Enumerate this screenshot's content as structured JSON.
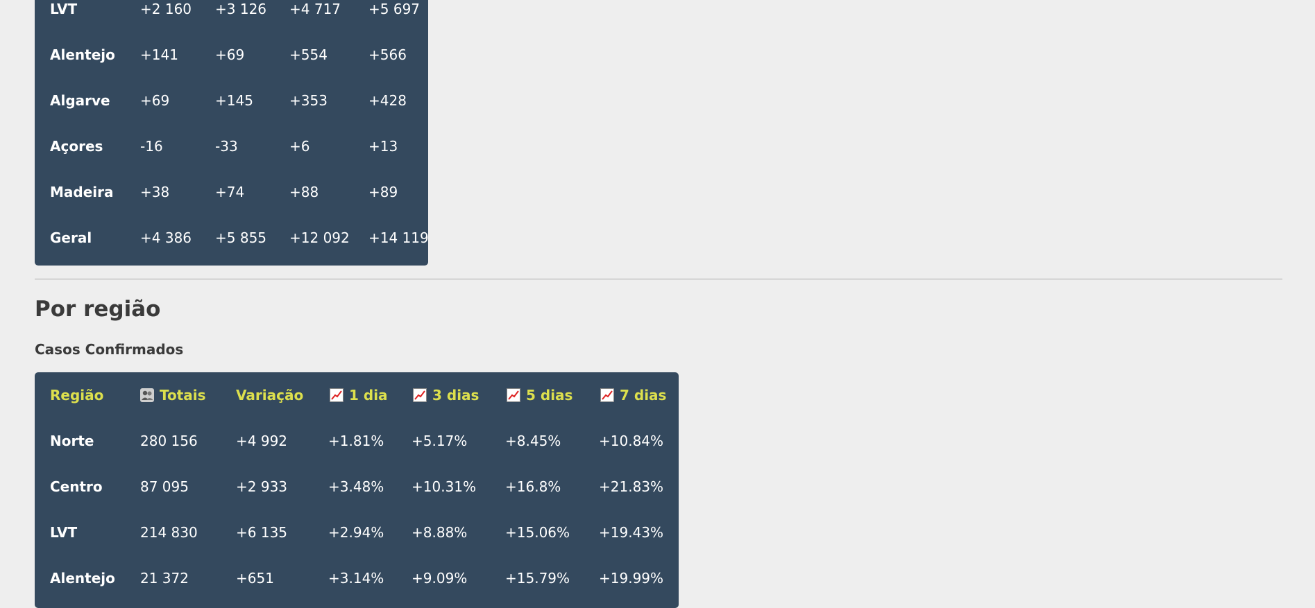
{
  "top_table": {
    "rows": [
      {
        "label": "LVT",
        "v": [
          "+2 160",
          "+3 126",
          "+4 717",
          "+5 697"
        ]
      },
      {
        "label": "Alentejo",
        "v": [
          "+141",
          "+69",
          "+554",
          "+566"
        ]
      },
      {
        "label": "Algarve",
        "v": [
          "+69",
          "+145",
          "+353",
          "+428"
        ]
      },
      {
        "label": "Açores",
        "v": [
          "-16",
          "-33",
          "+6",
          "+13"
        ]
      },
      {
        "label": "Madeira",
        "v": [
          "+38",
          "+74",
          "+88",
          "+89"
        ]
      },
      {
        "label": "Geral",
        "v": [
          "+4 386",
          "+5 855",
          "+12 092",
          "+14 119"
        ]
      }
    ]
  },
  "section": {
    "title": "Por região",
    "subtitle": "Casos Confirmados"
  },
  "region_table": {
    "headers": [
      "Região",
      "Totais",
      "Variação",
      "1 dia",
      "3 dias",
      "5 dias",
      "7 dias"
    ],
    "rows": [
      {
        "label": "Norte",
        "v": [
          "280 156",
          "+4 992",
          "+1.81%",
          "+5.17%",
          "+8.45%",
          "+10.84%"
        ]
      },
      {
        "label": "Centro",
        "v": [
          "87 095",
          "+2 933",
          "+3.48%",
          "+10.31%",
          "+16.8%",
          "+21.83%"
        ]
      },
      {
        "label": "LVT",
        "v": [
          "214 830",
          "+6 135",
          "+2.94%",
          "+8.88%",
          "+15.06%",
          "+19.43%"
        ]
      },
      {
        "label": "Alentejo",
        "v": [
          "21 372",
          "+651",
          "+3.14%",
          "+9.09%",
          "+15.79%",
          "+19.99%"
        ]
      }
    ]
  },
  "colors": {
    "background": "#eeeeee",
    "card": "#34495e",
    "header_text": "#dde04d",
    "cell_text": "#ffffff",
    "heading_text": "#3a3a3a"
  },
  "icons": {
    "totals": "people-icon",
    "trend": "chart-increasing-icon"
  }
}
